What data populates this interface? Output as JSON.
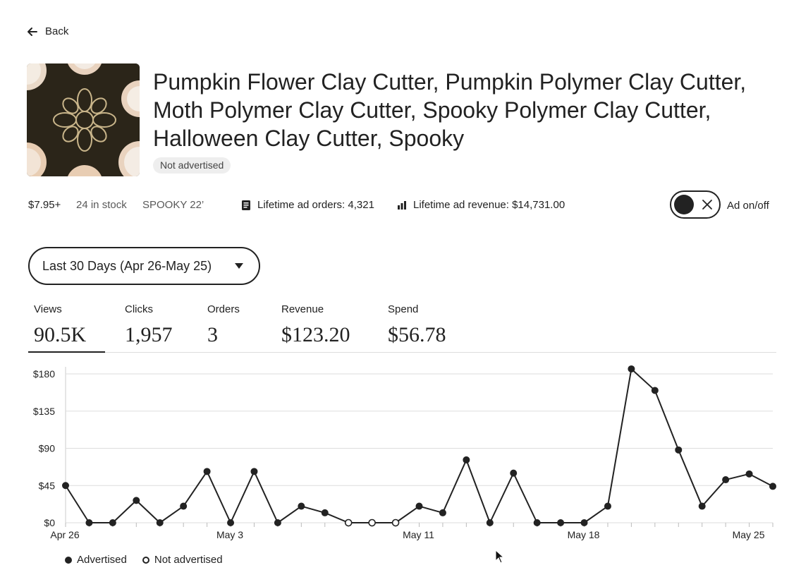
{
  "nav": {
    "back_label": "Back"
  },
  "listing": {
    "title": "Pumpkin Flower Clay Cutter, Pumpkin Polymer Clay Cutter, Moth Polymer Clay Cutter, Spooky Polymer Clay Cutter, Halloween Clay Cutter, Spooky",
    "ad_status_badge": "Not advertised",
    "price": "$7.95+",
    "stock": "24 in stock",
    "section": "SPOOKY 22’",
    "lifetime_orders": "Lifetime ad orders: 4,321",
    "lifetime_revenue": "Lifetime ad revenue: $14,731.00"
  },
  "ad_toggle": {
    "label": "Ad on/off",
    "state": "off"
  },
  "date_range": {
    "selected": "Last 30 Days (Apr 26-May 25)"
  },
  "metrics": [
    {
      "label": "Views",
      "value": "90.5K",
      "active": true
    },
    {
      "label": "Clicks",
      "value": "1,957",
      "active": false
    },
    {
      "label": "Orders",
      "value": "3",
      "active": false
    },
    {
      "label": "Revenue",
      "value": "$123.20",
      "active": false
    },
    {
      "label": "Spend",
      "value": "$56.78",
      "active": false
    }
  ],
  "legend": {
    "advertised": "Advertised",
    "not_advertised": "Not advertised"
  },
  "colors": {
    "text": "#222222",
    "muted": "#595959",
    "grid": "#dddddd",
    "badge_bg": "#eeeeee"
  },
  "chart_data": {
    "type": "line",
    "ylim": [
      0,
      180
    ],
    "yticks": [
      0,
      45,
      90,
      135,
      180
    ],
    "ytick_labels": [
      "$0",
      "$45",
      "$90",
      "$135",
      "$180"
    ],
    "xtick_labels": [
      {
        "label": "Apr 26",
        "index": 0
      },
      {
        "label": "May 3",
        "index": 7
      },
      {
        "label": "May 11",
        "index": 15
      },
      {
        "label": "May 18",
        "index": 22
      },
      {
        "label": "May 25",
        "index": 29
      }
    ],
    "series": [
      {
        "values": [
          45,
          0,
          0,
          27,
          0,
          20,
          62,
          0,
          62,
          0,
          20,
          12,
          0,
          0,
          0,
          20,
          12,
          76,
          0,
          60,
          0,
          0,
          0,
          20,
          186,
          160,
          88,
          20,
          52,
          59,
          44
        ],
        "advertised": [
          true,
          true,
          true,
          true,
          true,
          true,
          true,
          true,
          true,
          true,
          true,
          true,
          false,
          false,
          false,
          true,
          true,
          true,
          true,
          true,
          true,
          true,
          true,
          true,
          true,
          true,
          true,
          true,
          true,
          true,
          true
        ]
      }
    ],
    "grid": true,
    "legend_position": "bottom-left"
  }
}
